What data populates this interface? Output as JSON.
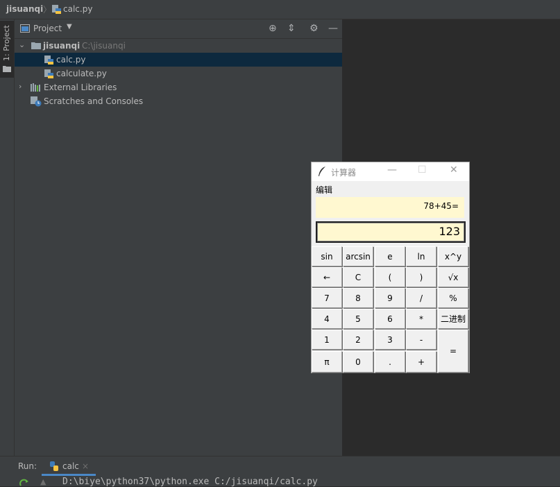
{
  "breadcrumb": {
    "root": "jisuanqi",
    "separator": "〉",
    "file": "calc.py"
  },
  "sidebar_strip": {
    "tab_label": "1: Project"
  },
  "project_panel": {
    "title": "Project",
    "tree": [
      {
        "label": "jisuanqi",
        "hint": "C:\\jisuanqi"
      },
      {
        "label": "calc.py"
      },
      {
        "label": "calculate.py"
      },
      {
        "label": "External Libraries"
      },
      {
        "label": "Scratches and Consoles"
      }
    ]
  },
  "run": {
    "label": "Run:",
    "tab": "calc",
    "command": "D:\\biye\\python37\\python.exe C:/jisuanqi/calc.py"
  },
  "calculator": {
    "title": "计算器",
    "menu": "编辑",
    "expression": "78+45=",
    "result": "123",
    "keys": [
      [
        "sin",
        "arcsin",
        "e",
        "ln",
        "x^y"
      ],
      [
        "←",
        "C",
        "(",
        ")",
        "√x"
      ],
      [
        "7",
        "8",
        "9",
        "/",
        "%"
      ],
      [
        "4",
        "5",
        "6",
        "*",
        "二进制"
      ],
      [
        "1",
        "2",
        "3",
        "-",
        "="
      ],
      [
        "π",
        "0",
        ".",
        "+"
      ]
    ]
  },
  "colors": {
    "ide_bg": "#2b2b2b",
    "panel_bg": "#3c3f41",
    "selection": "#0d293e",
    "calc_display": "#fff8d0"
  }
}
